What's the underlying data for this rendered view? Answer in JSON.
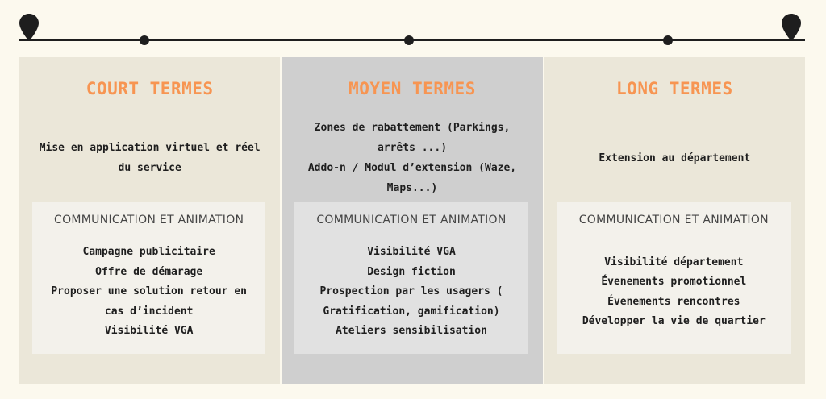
{
  "columns": [
    {
      "title": "COURT TERMES",
      "desc": [
        "Mise en application virtuel et réel",
        "du service"
      ],
      "box_title": "COMMUNICATION ET ANIMATION",
      "items": [
        "Campagne publicitaire",
        "Offre de démarage",
        "Proposer une solution retour en",
        "cas d’incident",
        "Visibilité VGA"
      ]
    },
    {
      "title": "MOYEN TERMES",
      "desc": [
        "Zones de rabattement (Parkings,",
        "arrêts ...)",
        "Addo-n / Modul d’extension (Waze,",
        "Maps...)"
      ],
      "box_title": "COMMUNICATION ET ANIMATION",
      "items": [
        "Visibilité VGA",
        "Design fiction",
        "Prospection par les usagers (",
        "Gratification, gamification)",
        "Ateliers sensibilisation"
      ]
    },
    {
      "title": "LONG TERMES",
      "desc": [
        "Extension au département"
      ],
      "box_title": "COMMUNICATION ET ANIMATION",
      "items": [
        "Visibilité département",
        "Évenements promotionnel",
        "Évenements rencontres",
        "Développer la vie de quartier"
      ]
    }
  ],
  "colors": {
    "title_accent": "#f79552",
    "panel_light": "#ebe7d9",
    "panel_mid": "#cfcfcf",
    "line": "#1e1e1e"
  },
  "icons": {
    "timeline_start": "map-pin-icon",
    "timeline_end": "map-pin-icon"
  }
}
